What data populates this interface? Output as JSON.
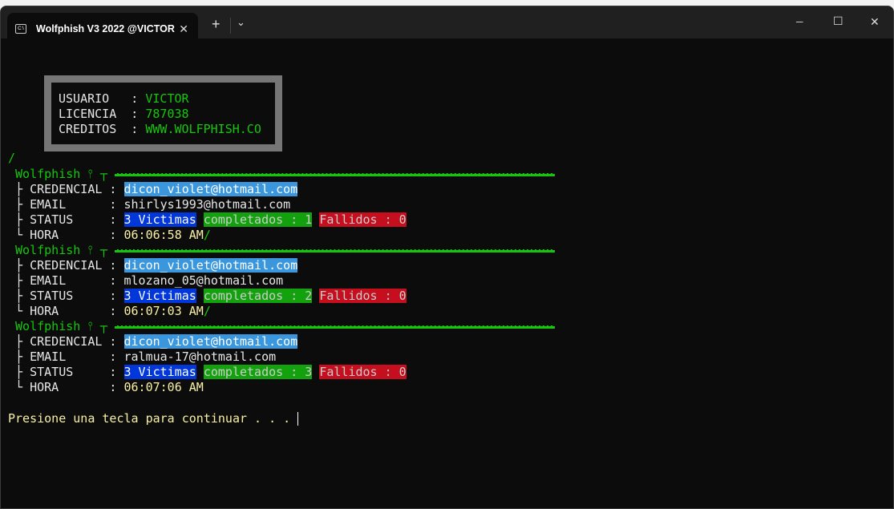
{
  "window": {
    "tab_title": "Wolfphish V3 2022 @VICTOR",
    "tab_icon": "cmd-icon",
    "new_tab": "+",
    "dropdown": "⌄",
    "minimize": "─",
    "maximize": "☐",
    "close": "✕",
    "tab_close": "✕"
  },
  "info_box": {
    "rows": [
      {
        "label": "USUARIO   : ",
        "value": "VICTOR"
      },
      {
        "label": "LICENCIA  : ",
        "value": "787038"
      },
      {
        "label": "CREDITOS  : ",
        "value": "WWW.WOLFPHISH.CO"
      }
    ]
  },
  "slash": "/",
  "header_label": "Wolfphish",
  "header_glyph": " ⫯ ┬ ",
  "labels": {
    "cred": " ├ CREDENCIAL : ",
    "email": " ├ EMAIL      : ",
    "status": " ├ STATUS     : ",
    "hora": " └ HORA       : "
  },
  "entries": [
    {
      "credencial": "dicon_violet@hotmail.com",
      "email": "shirlys1993@hotmail.com",
      "victimas": "3 Victimas",
      "completados": "completados : 1",
      "fallidos": "Fallidos : 0",
      "hora": "06:06:58 AM",
      "suffix": "/"
    },
    {
      "credencial": "dicon_violet@hotmail.com",
      "email": "mlozano_05@hotmail.com",
      "victimas": "3 Victimas",
      "completados": "completados : 2",
      "fallidos": "Fallidos : 0",
      "hora": "06:07:03 AM",
      "suffix": "/"
    },
    {
      "credencial": "dicon_violet@hotmail.com",
      "email": "ralmua-17@hotmail.com",
      "victimas": "3 Victimas",
      "completados": "completados : 3",
      "fallidos": "Fallidos : 0",
      "hora": "06:07:06 AM",
      "suffix": ""
    }
  ],
  "prompt": "Presione una tecla para continuar . . . "
}
